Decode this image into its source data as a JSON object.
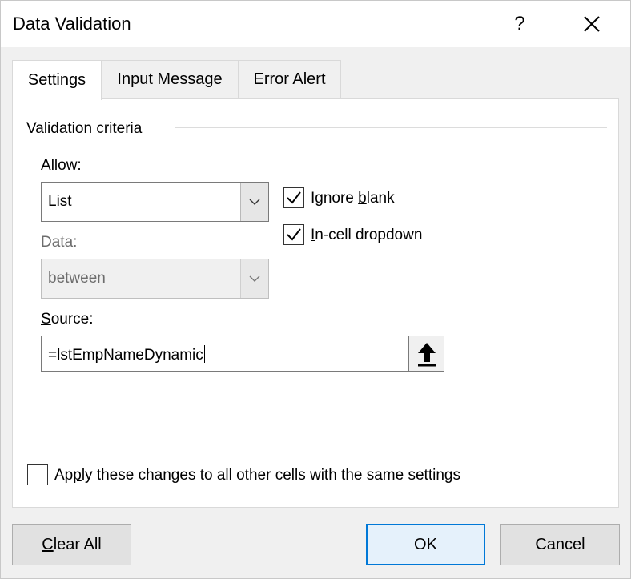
{
  "window": {
    "title": "Data Validation",
    "help_label": "?"
  },
  "tabs": [
    {
      "label": "Settings",
      "active": true
    },
    {
      "label": "Input Message",
      "active": false
    },
    {
      "label": "Error Alert",
      "active": false
    }
  ],
  "settings": {
    "group_label": "Validation criteria",
    "allow": {
      "label_accel": "A",
      "label_rest": "llow:",
      "value": "List"
    },
    "data": {
      "label": "Data:",
      "value": "between",
      "enabled": false
    },
    "ignore_blank": {
      "label_pre": "Ignore ",
      "label_accel": "b",
      "label_post": "lank",
      "checked": true
    },
    "in_cell_dropdown": {
      "label_accel": "I",
      "label_rest": "n-cell dropdown",
      "checked": true
    },
    "source": {
      "label_accel": "S",
      "label_rest": "ource:",
      "value": "=lstEmpNameDynamic"
    },
    "apply_all": {
      "label_pre": "Ap",
      "label_accel": "p",
      "label_post": "ly these changes to all other cells with the same settings",
      "checked": false
    }
  },
  "buttons": {
    "clear_all": {
      "label_accel": "C",
      "label_rest": "lear All"
    },
    "ok": "OK",
    "cancel": "Cancel"
  },
  "colors": {
    "accent": "#0078d7",
    "window_bg": "#f0f0f0",
    "panel_bg": "#ffffff"
  }
}
